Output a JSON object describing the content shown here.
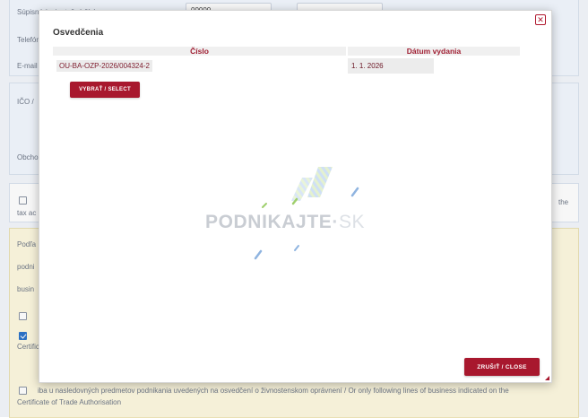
{
  "background": {
    "labels": {
      "supisne": "Súpisné / orientačné číslo",
      "supisne_value": "00000",
      "telefon": "Telefón",
      "email": "E-mail",
      "ico": "IČO / ",
      "obchodne": "Obcho",
      "tax_prefix": "tax ac",
      "tax_suffix": "the",
      "podla": "Podľa",
      "podnik": "podni",
      "busin": "busin",
      "certif": "Certific",
      "bottom_line1": "iba u nasledovných predmetov podnikania uvedených na osvedčení o živnostenskom oprávnení / Or only following lines of business indicated on the",
      "bottom_line2": "Certificate of Trade Authorisation"
    }
  },
  "modal": {
    "title": "Osvedčenia",
    "close_icon": "close-icon",
    "table": {
      "headers": [
        "Číslo",
        "Dátum vydania"
      ],
      "rows": [
        {
          "number": "OU-BA-OZP-2026/004324-2",
          "date": "1. 1. 2026"
        }
      ]
    },
    "select_button": "VYBRAŤ / SELECT",
    "close_button": "ZRUŠIŤ / CLOSE",
    "logo": {
      "main": "PODNIKAJTE",
      "dot": "·",
      "suffix": "SK"
    }
  },
  "colors": {
    "accent": "#a8182e",
    "header_text": "#a01f33",
    "yellow_panel": "#fdf8df",
    "blue_panel": "#f2f7fe"
  }
}
